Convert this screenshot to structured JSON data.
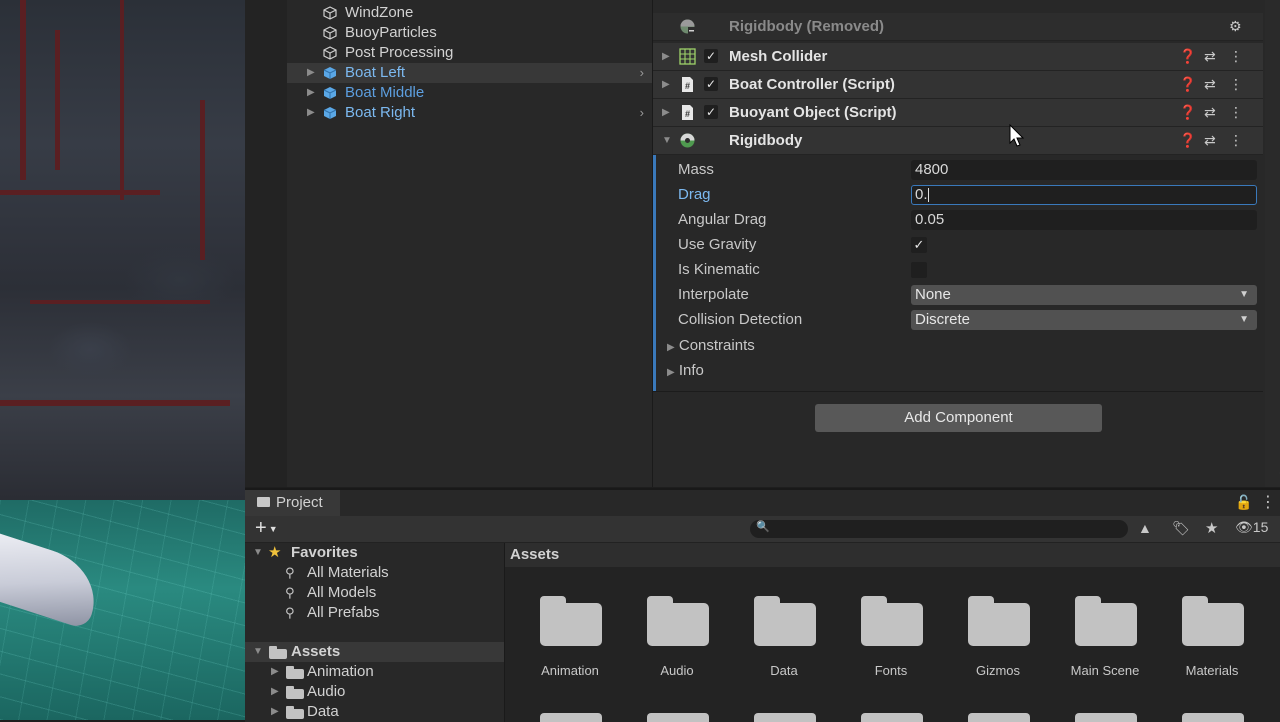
{
  "hierarchy": {
    "items": [
      {
        "label": "WindZone",
        "style": "normal"
      },
      {
        "label": "BuoyParticles",
        "style": "normal"
      },
      {
        "label": "Post Processing",
        "style": "normal"
      },
      {
        "label": "Boat Left",
        "style": "prefab",
        "selected": true
      },
      {
        "label": "Boat Middle",
        "style": "prefab-highlight"
      },
      {
        "label": "Boat Right",
        "style": "prefab"
      }
    ]
  },
  "inspector": {
    "components": [
      {
        "name": "Rigidbody (Removed)",
        "icon": "rigidbody-removed-icon",
        "enabled": null
      },
      {
        "name": "Mesh Collider",
        "icon": "mesh-collider-icon",
        "enabled": true
      },
      {
        "name": "Boat Controller (Script)",
        "icon": "script-icon",
        "enabled": true
      },
      {
        "name": "Buoyant Object (Script)",
        "icon": "script-icon",
        "enabled": true
      },
      {
        "name": "Rigidbody",
        "icon": "rigidbody-icon",
        "enabled": null
      }
    ],
    "rigidbody": {
      "mass_label": "Mass",
      "mass_value": "4800",
      "drag_label": "Drag",
      "drag_value": "0.",
      "angular_drag_label": "Angular Drag",
      "angular_drag_value": "0.05",
      "use_gravity_label": "Use Gravity",
      "use_gravity": true,
      "is_kinematic_label": "Is Kinematic",
      "is_kinematic": false,
      "interpolate_label": "Interpolate",
      "interpolate_value": "None",
      "collision_label": "Collision Detection",
      "collision_value": "Discrete",
      "constraints_label": "Constraints",
      "info_label": "Info"
    },
    "add_component_label": "Add Component"
  },
  "project": {
    "tab_label": "Project",
    "add_label": "+",
    "hidden_count": "15",
    "favorites_label": "Favorites",
    "favorites": [
      "All Materials",
      "All Models",
      "All Prefabs"
    ],
    "assets_label": "Assets",
    "asset_tree": [
      "Animation",
      "Audio",
      "Data"
    ],
    "grid_header": "Assets",
    "folders": [
      "Animation",
      "Audio",
      "Data",
      "Fonts",
      "Gizmos",
      "Main Scene",
      "Materials"
    ]
  },
  "colors": {
    "accent": "#3a79bb",
    "prefab_text": "#7cb9f0",
    "panel": "#282828"
  }
}
